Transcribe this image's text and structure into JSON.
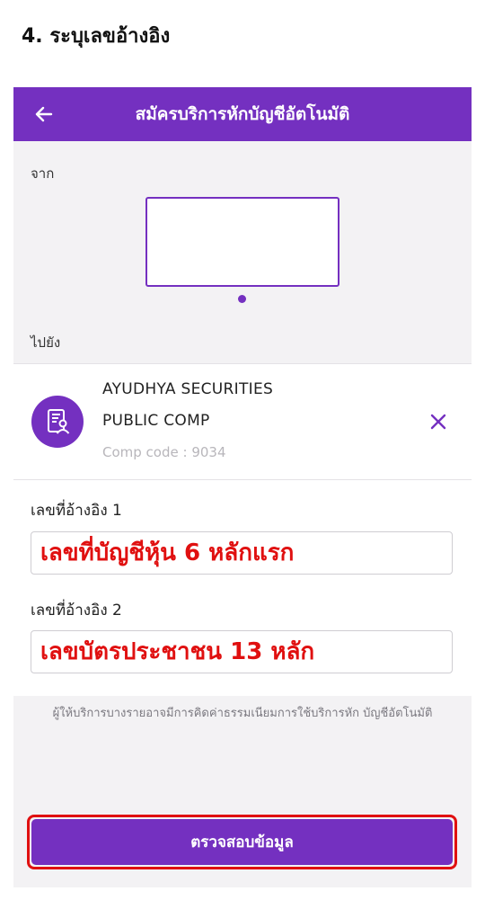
{
  "step_title": "4. ระบุเลขอ้างอิง",
  "header": {
    "title": "สมัครบริการหักบัญชีอัตโนมัติ",
    "back_icon": "arrow-left-icon"
  },
  "from": {
    "label": "จาก"
  },
  "to": {
    "label": "ไปยัง"
  },
  "biller": {
    "name_line1": "AYUDHYA SECURITIES",
    "name_line2": "PUBLIC COMP",
    "code": "Comp code : 9034",
    "icon": "document-person-icon",
    "remove_icon": "close-icon"
  },
  "reference": {
    "ref1_label": "เลขที่อ้างอิง 1",
    "ref1_value": "เลขที่บัญชีหุ้น 6 หลักแรก",
    "ref2_label": "เลขที่อ้างอิง 2",
    "ref2_value": "เลขบัตรประชาชน 13 หลัก"
  },
  "disclaimer": "ผู้ให้บริการบางรายอาจมีการคิดค่าธรรมเนียมการใช้บริการหัก บัญชีอัตโนมัติ",
  "submit_label": "ตรวจสอบข้อมูล",
  "colors": {
    "brand_purple": "#7430c0",
    "highlight_red": "#e01010"
  }
}
